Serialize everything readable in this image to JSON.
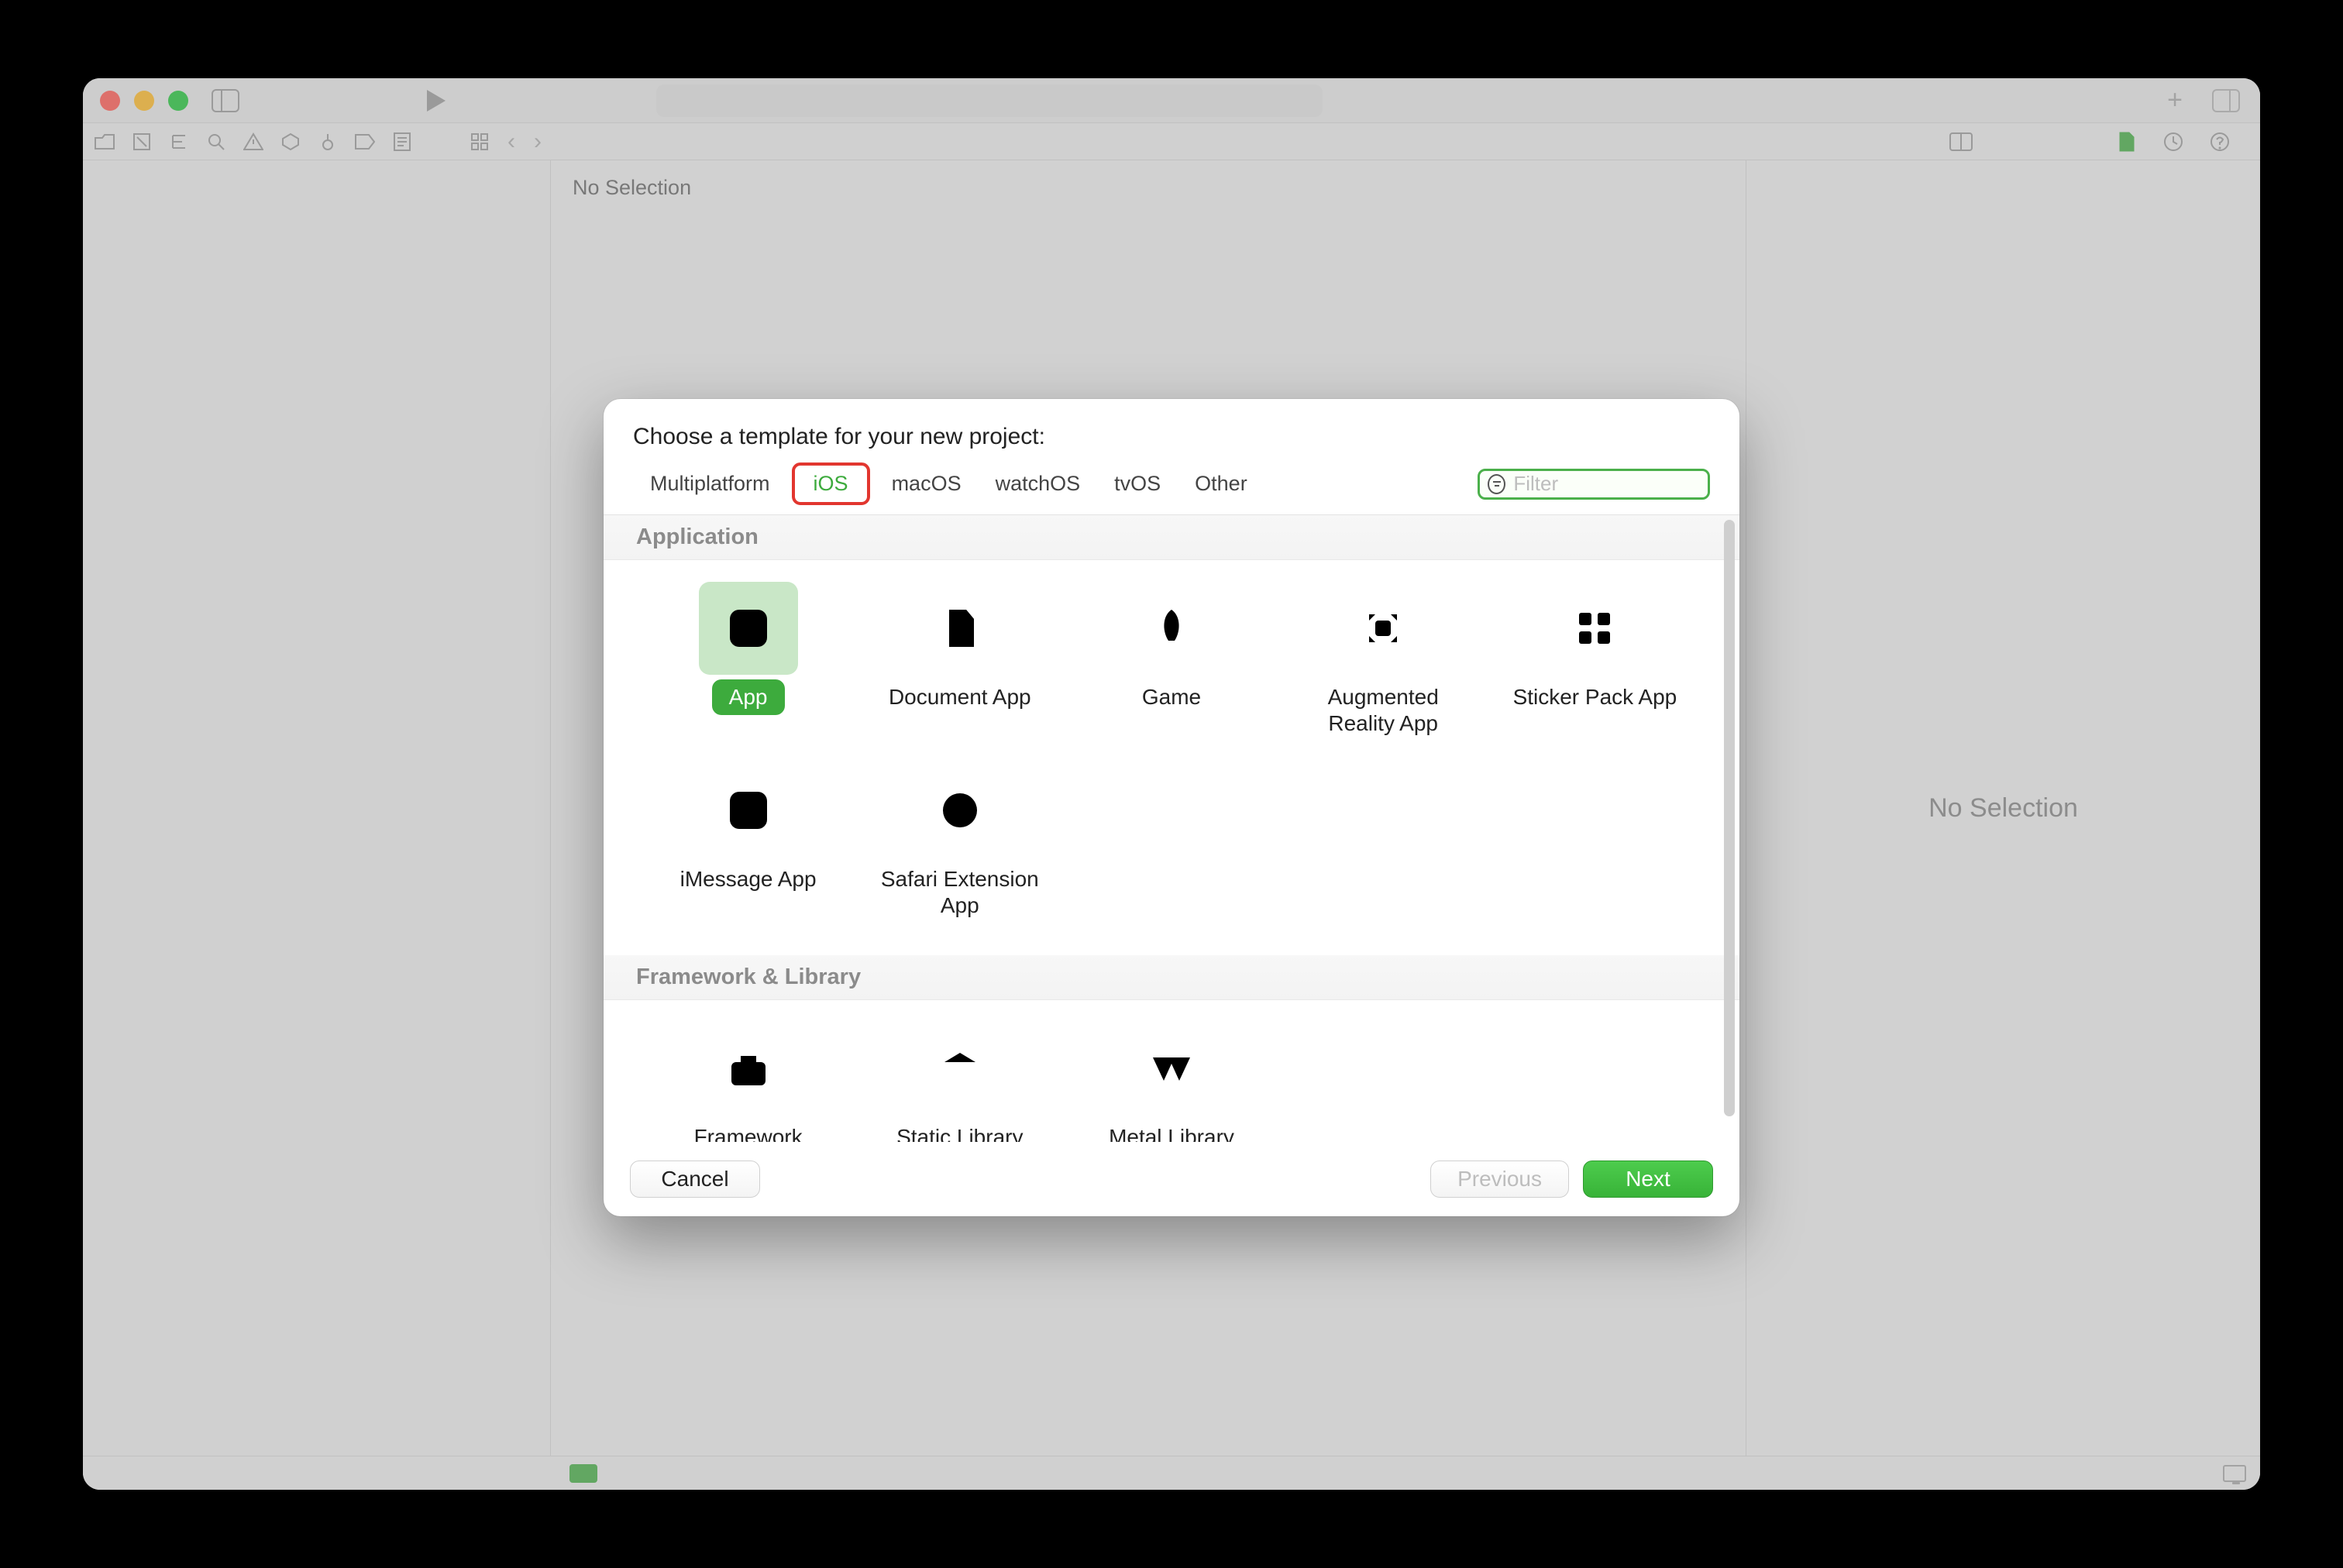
{
  "window": {
    "no_selection_label_left": "No Selection",
    "inspector_placeholder": "No Selection"
  },
  "modal": {
    "title": "Choose a template for your new project:",
    "tabs": [
      "Multiplatform",
      "iOS",
      "macOS",
      "watchOS",
      "tvOS",
      "Other"
    ],
    "selected_tab": "iOS",
    "filter_placeholder": "Filter",
    "sections": [
      {
        "header": "Application",
        "items": [
          {
            "id": "app",
            "label": "App",
            "icon": "app-icon",
            "selected": true
          },
          {
            "id": "document-app",
            "label": "Document App",
            "icon": "document-icon"
          },
          {
            "id": "game",
            "label": "Game",
            "icon": "rocket-icon"
          },
          {
            "id": "ar-app",
            "label": "Augmented\nReality App",
            "icon": "ar-icon"
          },
          {
            "id": "sticker-pack",
            "label": "Sticker Pack App",
            "icon": "grid-icon"
          },
          {
            "id": "imessage-app",
            "label": "iMessage App",
            "icon": "app-icon"
          },
          {
            "id": "safari-ext",
            "label": "Safari Extension\nApp",
            "icon": "compass-icon"
          }
        ]
      },
      {
        "header": "Framework & Library",
        "items": [
          {
            "id": "framework",
            "label": "Framework",
            "icon": "toolbox-icon"
          },
          {
            "id": "static-lib",
            "label": "Static Library",
            "icon": "library-icon"
          },
          {
            "id": "metal-lib",
            "label": "Metal Library",
            "icon": "metal-icon"
          }
        ]
      }
    ],
    "buttons": {
      "cancel": "Cancel",
      "previous": "Previous",
      "next": "Next"
    },
    "colors": {
      "accent": "#4bb04b"
    }
  }
}
